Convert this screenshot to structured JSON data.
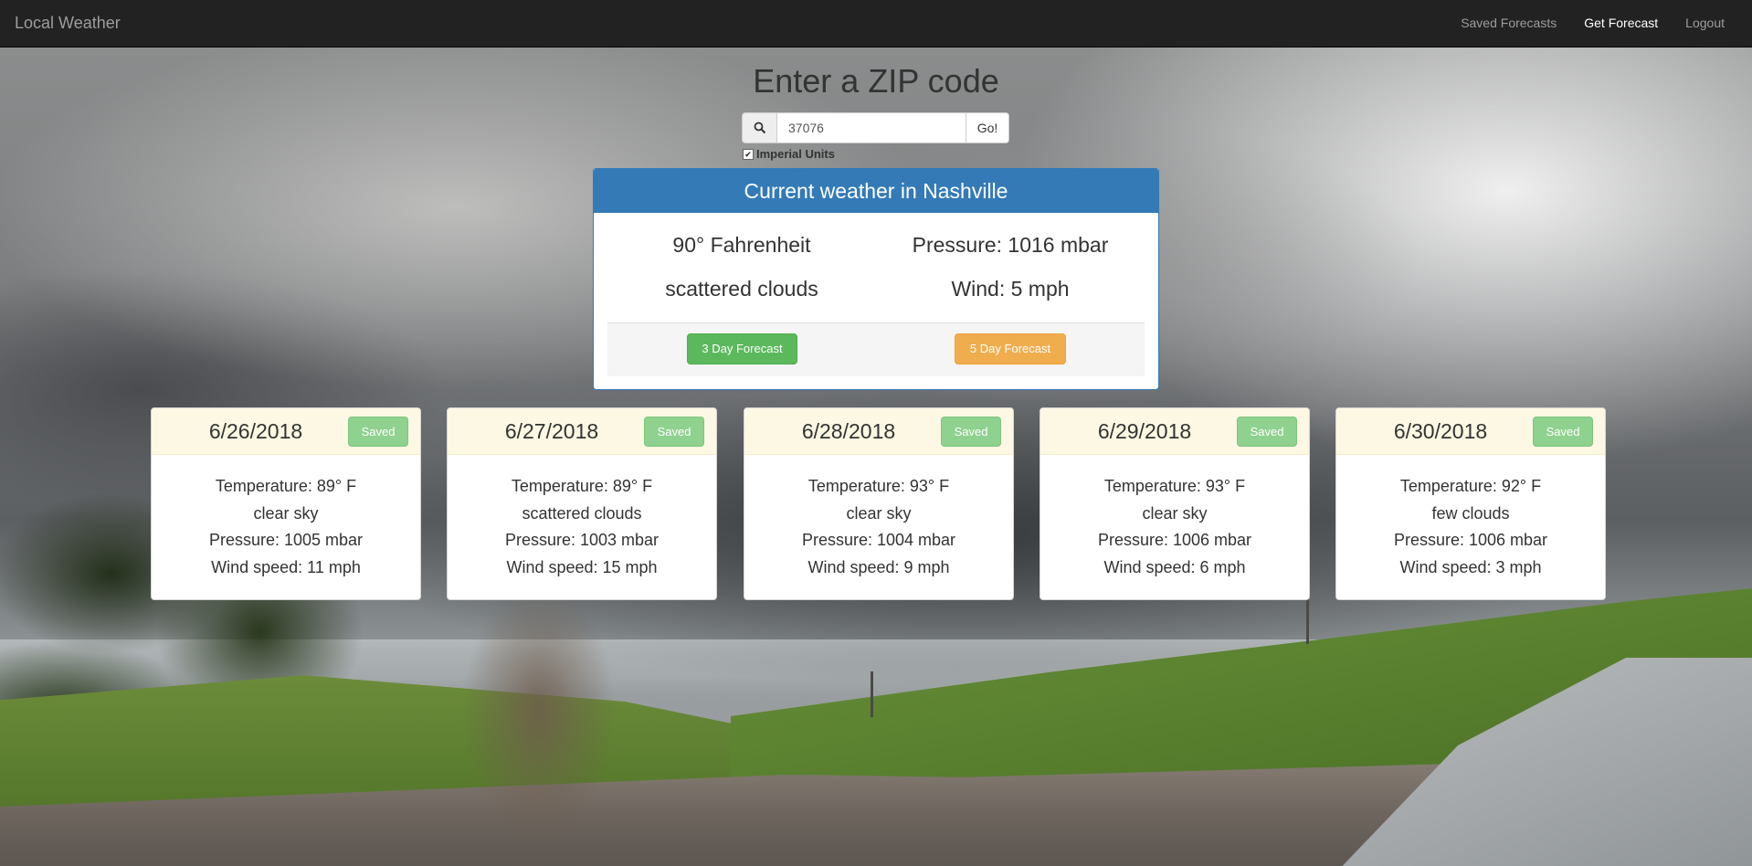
{
  "navbar": {
    "brand": "Local Weather",
    "links": [
      {
        "label": "Saved Forecasts",
        "active": false
      },
      {
        "label": "Get Forecast",
        "active": true
      },
      {
        "label": "Logout",
        "active": false
      }
    ]
  },
  "search": {
    "title": "Enter a ZIP code",
    "zip_value": "37076",
    "go_label": "Go!",
    "imperial_label": "Imperial Units",
    "imperial_checked": true
  },
  "current": {
    "header": "Current weather in Nashville",
    "temperature": "90° Fahrenheit",
    "pressure": "Pressure: 1016 mbar",
    "description": "scattered clouds",
    "wind": "Wind: 5 mph",
    "three_day_label": "3 Day Forecast",
    "five_day_label": "5 Day Forecast"
  },
  "forecast": [
    {
      "date": "6/26/2018",
      "saved_label": "Saved",
      "temperature": "Temperature: 89° F",
      "description": "clear sky",
      "pressure": "Pressure: 1005 mbar",
      "wind": "Wind speed: 11 mph"
    },
    {
      "date": "6/27/2018",
      "saved_label": "Saved",
      "temperature": "Temperature: 89° F",
      "description": "scattered clouds",
      "pressure": "Pressure: 1003 mbar",
      "wind": "Wind speed: 15 mph"
    },
    {
      "date": "6/28/2018",
      "saved_label": "Saved",
      "temperature": "Temperature: 93° F",
      "description": "clear sky",
      "pressure": "Pressure: 1004 mbar",
      "wind": "Wind speed: 9 mph"
    },
    {
      "date": "6/29/2018",
      "saved_label": "Saved",
      "temperature": "Temperature: 93° F",
      "description": "clear sky",
      "pressure": "Pressure: 1006 mbar",
      "wind": "Wind speed: 6 mph"
    },
    {
      "date": "6/30/2018",
      "saved_label": "Saved",
      "temperature": "Temperature: 92° F",
      "description": "few clouds",
      "pressure": "Pressure: 1006 mbar",
      "wind": "Wind speed: 3 mph"
    }
  ],
  "colors": {
    "navbar_bg": "#222222",
    "primary": "#337ab7",
    "success": "#5cb85c",
    "warning": "#f0ad4e",
    "saved_badge": "#8fd18f",
    "card_header": "#fcf8e3"
  },
  "icons": {
    "search_addon": "search-icon",
    "checkbox": "checkbox-checked-icon"
  }
}
